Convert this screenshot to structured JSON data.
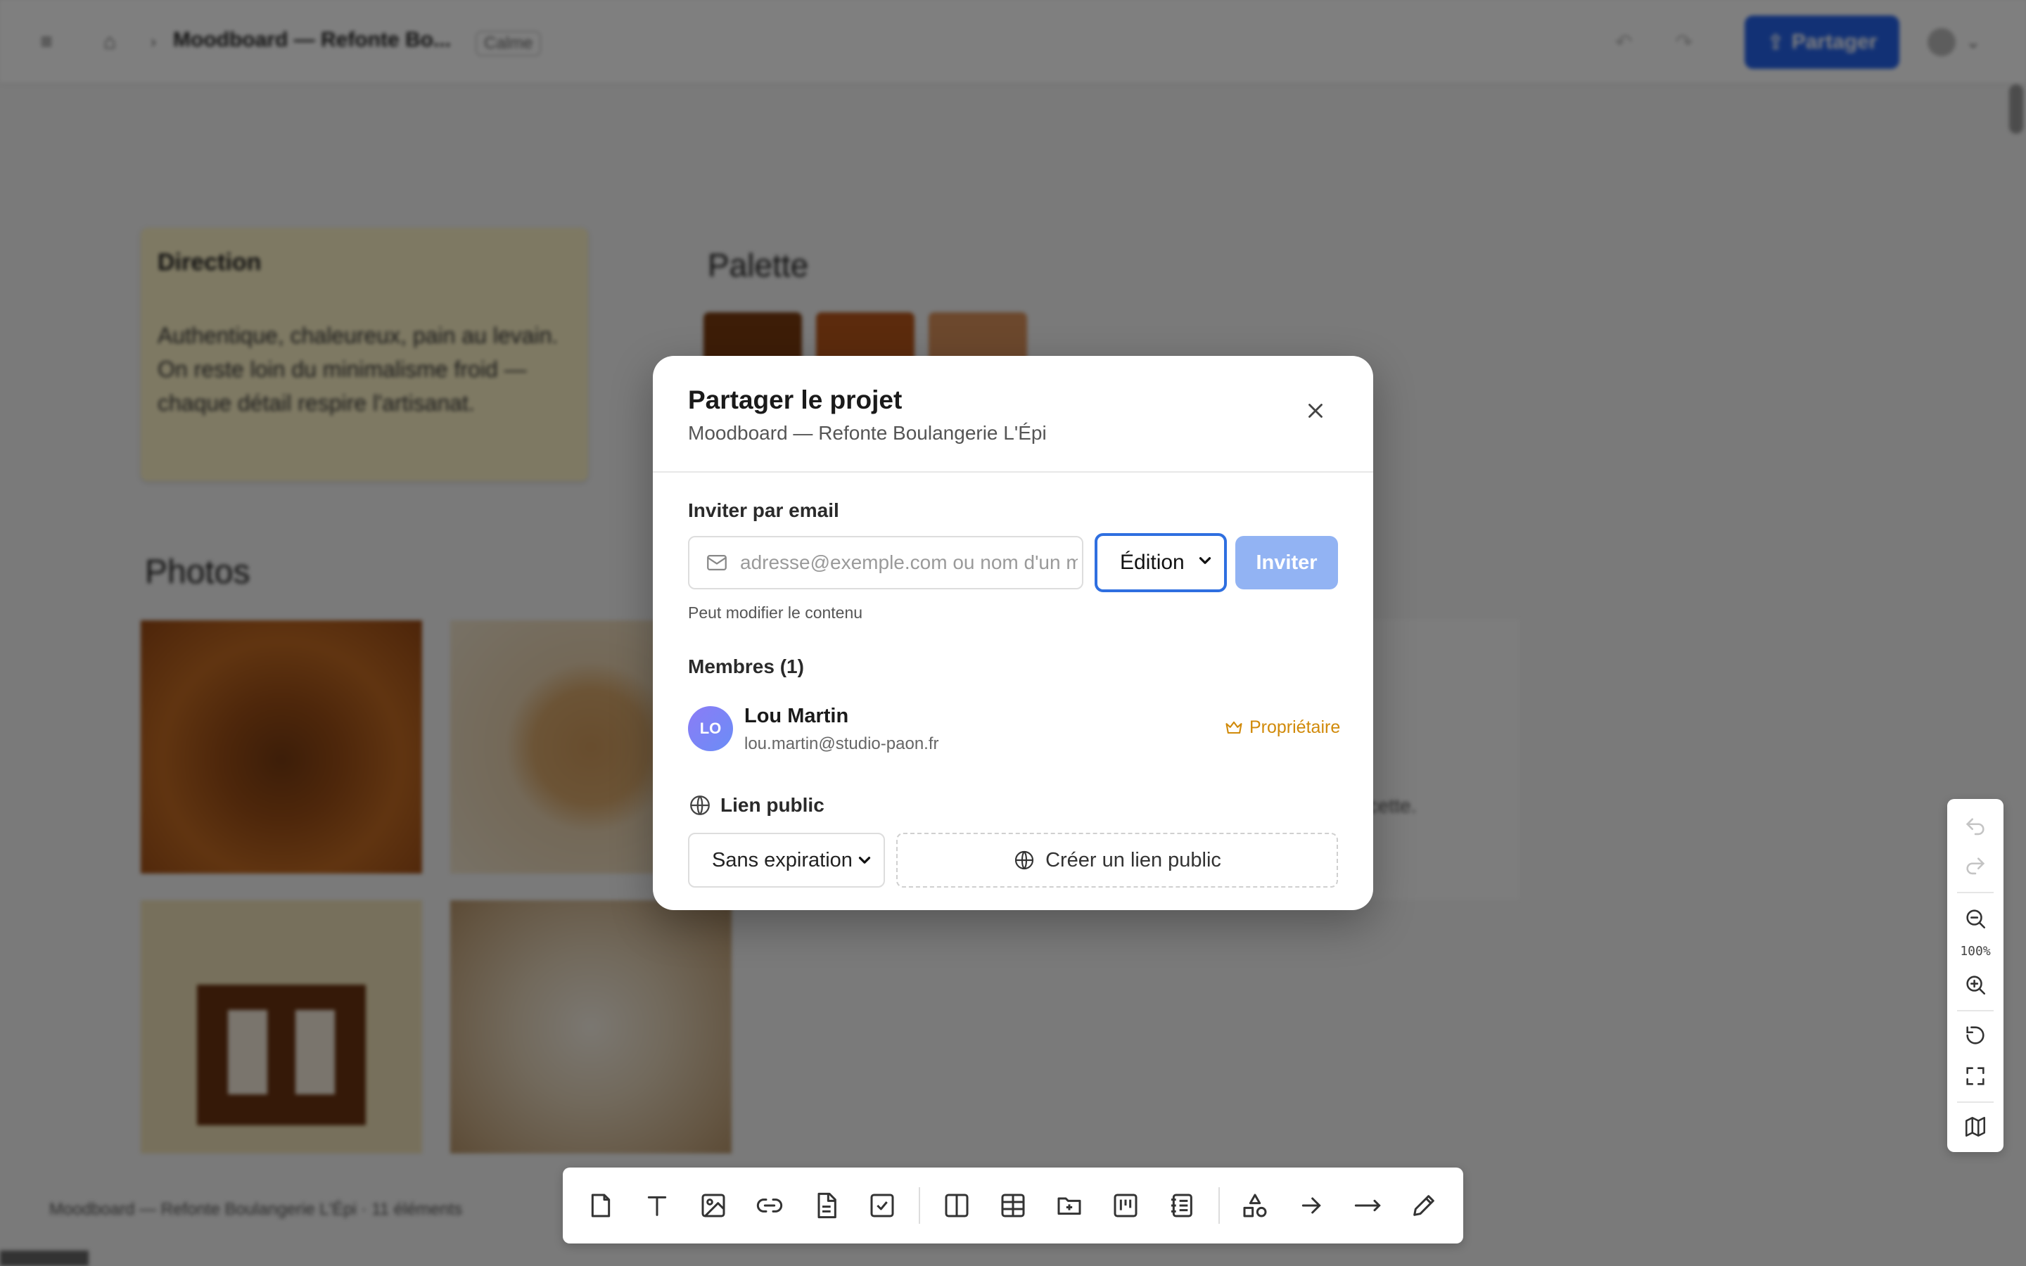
{
  "topbar": {
    "title": "Moodboard — Refonte Bo...",
    "badge": "Calme",
    "share_label": "Partager"
  },
  "canvas": {
    "note": {
      "title": "Direction",
      "body": "Authentique, chaleureux, pain au levain. On reste loin du minimalisme froid — chaque détail respire l'artisanat."
    },
    "palette_title": "Palette",
    "swatches": [
      "#7a3a0e",
      "#b8561a",
      "#d9905a"
    ],
    "photos_title": "Photos",
    "side_text": "recette.",
    "footer_label": "Moodboard — Refonte Boulangerie L'Épi · 11 éléments"
  },
  "modal": {
    "title": "Partager le projet",
    "subtitle": "Moodboard — Refonte Boulangerie L'Épi",
    "invite_section": "Inviter par email",
    "email_placeholder": "adresse@exemple.com ou nom d'un membre",
    "email_value": "",
    "role_selected": "Édition",
    "invite_label": "Inviter",
    "role_hint": "Peut modifier le contenu",
    "members_title": "Membres (1)",
    "members": [
      {
        "initials": "LO",
        "name": "Lou Martin",
        "email": "lou.martin@studio-paon.fr",
        "role": "Propriétaire"
      }
    ],
    "public_link_title": "Lien public",
    "expiration_selected": "Sans expiration",
    "create_link_label": "Créer un lien public"
  },
  "zoom": {
    "level": "100%"
  },
  "colors": {
    "primary": "#2563eb",
    "primary_disabled": "#92b3f3",
    "focus_ring": "#2f6fe0",
    "owner_badge": "#d18a0a",
    "overlay": "rgba(0,0,0,0.5)"
  },
  "toolbar_icons": [
    "note-icon",
    "text-icon",
    "image-icon",
    "link-icon",
    "document-icon",
    "todo-icon",
    "column-icon",
    "table-icon",
    "folder-icon",
    "board-icon",
    "list-icon",
    "shapes-icon",
    "arrow-icon",
    "line-icon",
    "pen-icon"
  ]
}
